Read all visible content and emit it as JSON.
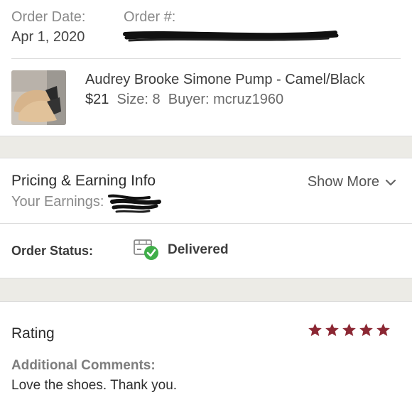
{
  "order": {
    "date_label": "Order Date:",
    "date_value": "Apr 1, 2020",
    "number_label": "Order #:"
  },
  "item": {
    "title": "Audrey Brooke Simone Pump - Camel/Black",
    "price": "$21",
    "size": "Size: 8",
    "buyer": "Buyer: mcruz1960"
  },
  "pricing": {
    "title": "Pricing & Earning Info",
    "earnings_label": "Your Earnings:",
    "show_more": "Show More"
  },
  "status": {
    "label": "Order Status:",
    "value": "Delivered",
    "icon": "delivered-box-icon"
  },
  "rating": {
    "title": "Rating",
    "stars": 5,
    "star_color": "#8b2733",
    "comments_label": "Additional Comments:",
    "comments": "Love the shoes. Thank you."
  }
}
